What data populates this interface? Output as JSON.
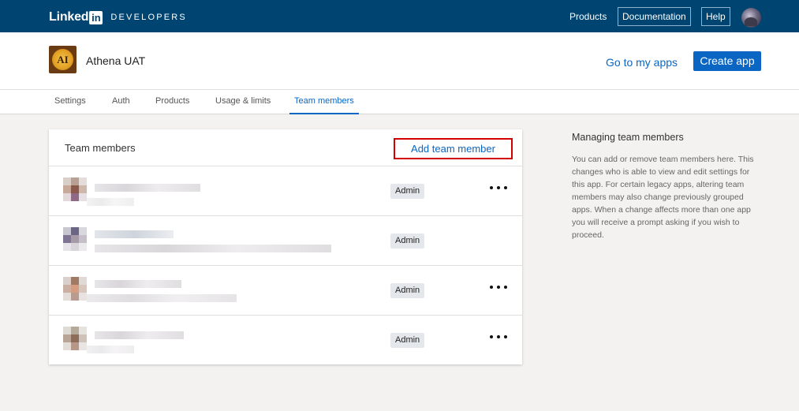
{
  "topnav": {
    "logo_word": "Linked",
    "logo_in": "in",
    "logo_suffix": "DEVELOPERS",
    "products": "Products",
    "documentation": "Documentation",
    "help": "Help"
  },
  "app": {
    "icon_text": "AI",
    "name": "Athena UAT",
    "goto_label": "Go to my apps",
    "create_label": "Create app"
  },
  "tabs": [
    {
      "label": "Settings"
    },
    {
      "label": "Auth"
    },
    {
      "label": "Products"
    },
    {
      "label": "Usage & limits"
    },
    {
      "label": "Team members",
      "active": true
    }
  ],
  "team": {
    "title": "Team members",
    "add_label": "Add team member",
    "members": [
      {
        "role": "Admin",
        "has_menu": true
      },
      {
        "role": "Admin",
        "has_menu": false
      },
      {
        "role": "Admin",
        "has_menu": true
      },
      {
        "role": "Admin",
        "has_menu": true
      }
    ]
  },
  "sidebar": {
    "title": "Managing team members",
    "text": "You can add or remove team members here. This changes who is able to view and edit settings for this app. For certain legacy apps, altering team members may also change previously grouped apps. When a change affects more than one app you will receive a prompt asking if you wish to proceed."
  },
  "colors": {
    "nav_bg": "#004471",
    "accent": "#0a66c2",
    "highlight_border": "#d20000"
  }
}
